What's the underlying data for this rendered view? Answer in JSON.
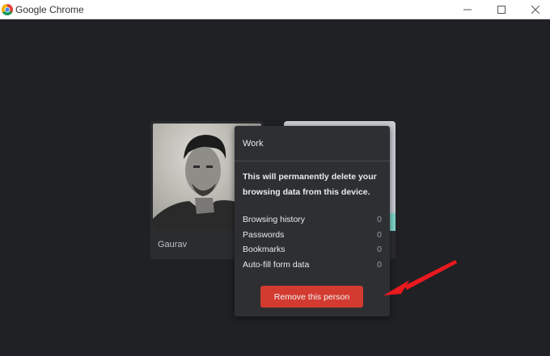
{
  "window": {
    "title": "Google Chrome"
  },
  "profiles": [
    {
      "name": "Gaurav"
    }
  ],
  "remove_dialog": {
    "profile_name": "Work",
    "warning": "This will permanently delete your browsing data from this device.",
    "stats": [
      {
        "label": "Browsing history",
        "value": "0"
      },
      {
        "label": "Passwords",
        "value": "0"
      },
      {
        "label": "Bookmarks",
        "value": "0"
      },
      {
        "label": "Auto-fill form data",
        "value": "0"
      }
    ],
    "remove_button_label": "Remove this person"
  },
  "colors": {
    "background": "#202124",
    "dialog": "#2e2f33",
    "remove_button": "#d33b30",
    "annotation_arrow": "#e8191f"
  },
  "icons": {
    "app": "chrome-logo-icon",
    "minimize": "minimize-icon",
    "maximize": "maximize-icon",
    "close": "close-icon",
    "annotation": "red-arrow-icon"
  }
}
